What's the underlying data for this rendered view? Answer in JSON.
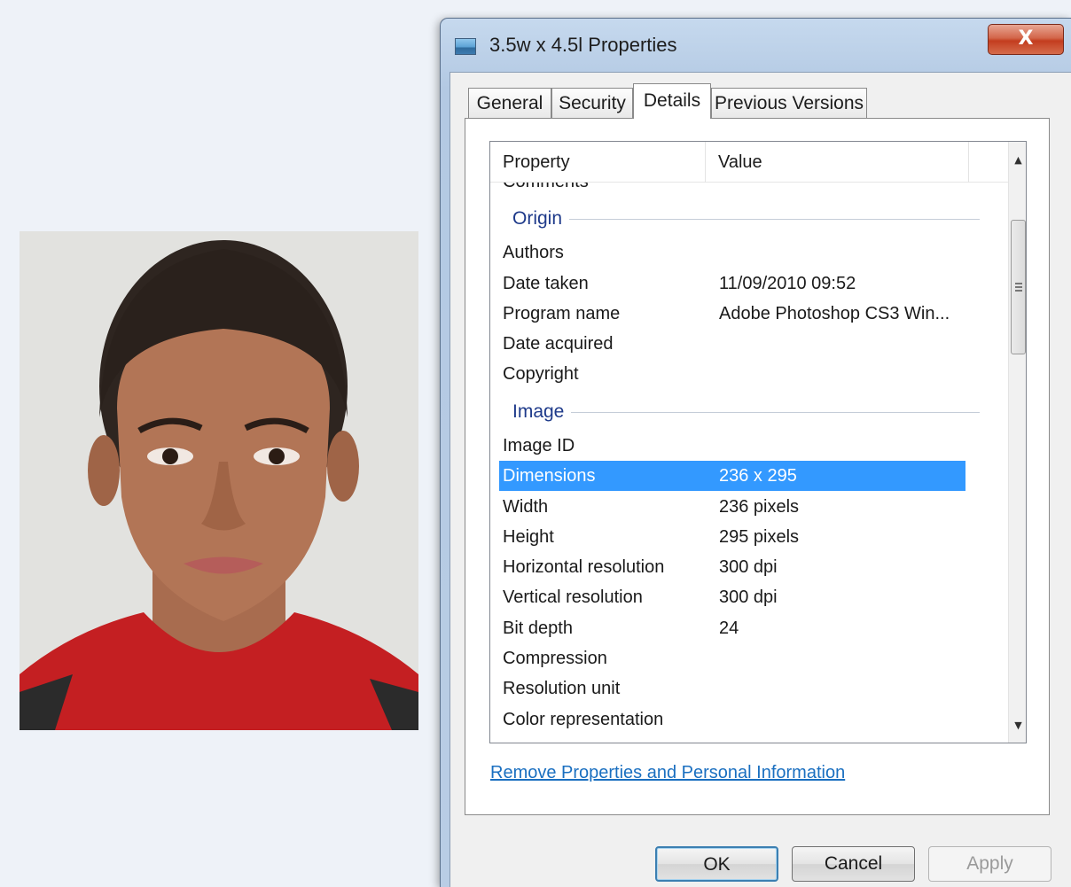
{
  "window": {
    "title": "3.5w x 4.5l Properties",
    "close_glyph": "X",
    "close_icon": "close-icon",
    "title_icon": "image-file-icon"
  },
  "tabs": [
    {
      "label": "General",
      "active": false
    },
    {
      "label": "Security",
      "active": false
    },
    {
      "label": "Details",
      "active": true
    },
    {
      "label": "Previous Versions",
      "active": false
    }
  ],
  "list": {
    "columns": {
      "property": "Property",
      "value": "Value"
    },
    "cut_off_row": "Comments",
    "groups": [
      {
        "name": "Origin",
        "rows": [
          {
            "property": "Authors",
            "value": ""
          },
          {
            "property": "Date taken",
            "value": "11/09/2010 09:52"
          },
          {
            "property": "Program name",
            "value": "Adobe Photoshop CS3 Win..."
          },
          {
            "property": "Date acquired",
            "value": ""
          },
          {
            "property": "Copyright",
            "value": ""
          }
        ]
      },
      {
        "name": "Image",
        "rows": [
          {
            "property": "Image ID",
            "value": ""
          },
          {
            "property": "Dimensions",
            "value": "236 x 295",
            "selected": true
          },
          {
            "property": "Width",
            "value": "236 pixels"
          },
          {
            "property": "Height",
            "value": "295 pixels"
          },
          {
            "property": "Horizontal resolution",
            "value": "300 dpi"
          },
          {
            "property": "Vertical resolution",
            "value": "300 dpi"
          },
          {
            "property": "Bit depth",
            "value": "24"
          },
          {
            "property": "Compression",
            "value": ""
          },
          {
            "property": "Resolution unit",
            "value": ""
          },
          {
            "property": "Color representation",
            "value": ""
          }
        ]
      }
    ],
    "scrollbar": {
      "up_glyph": "▲",
      "down_glyph": "▼",
      "position": 0.25
    }
  },
  "link_text": "Remove Properties and Personal Information",
  "buttons": {
    "ok": "OK",
    "cancel": "Cancel",
    "apply": "Apply"
  },
  "colors": {
    "selection": "#3399ff",
    "group_header": "#1e3a8a",
    "link": "#1a6fc0",
    "close_button": "#c33d1f"
  }
}
